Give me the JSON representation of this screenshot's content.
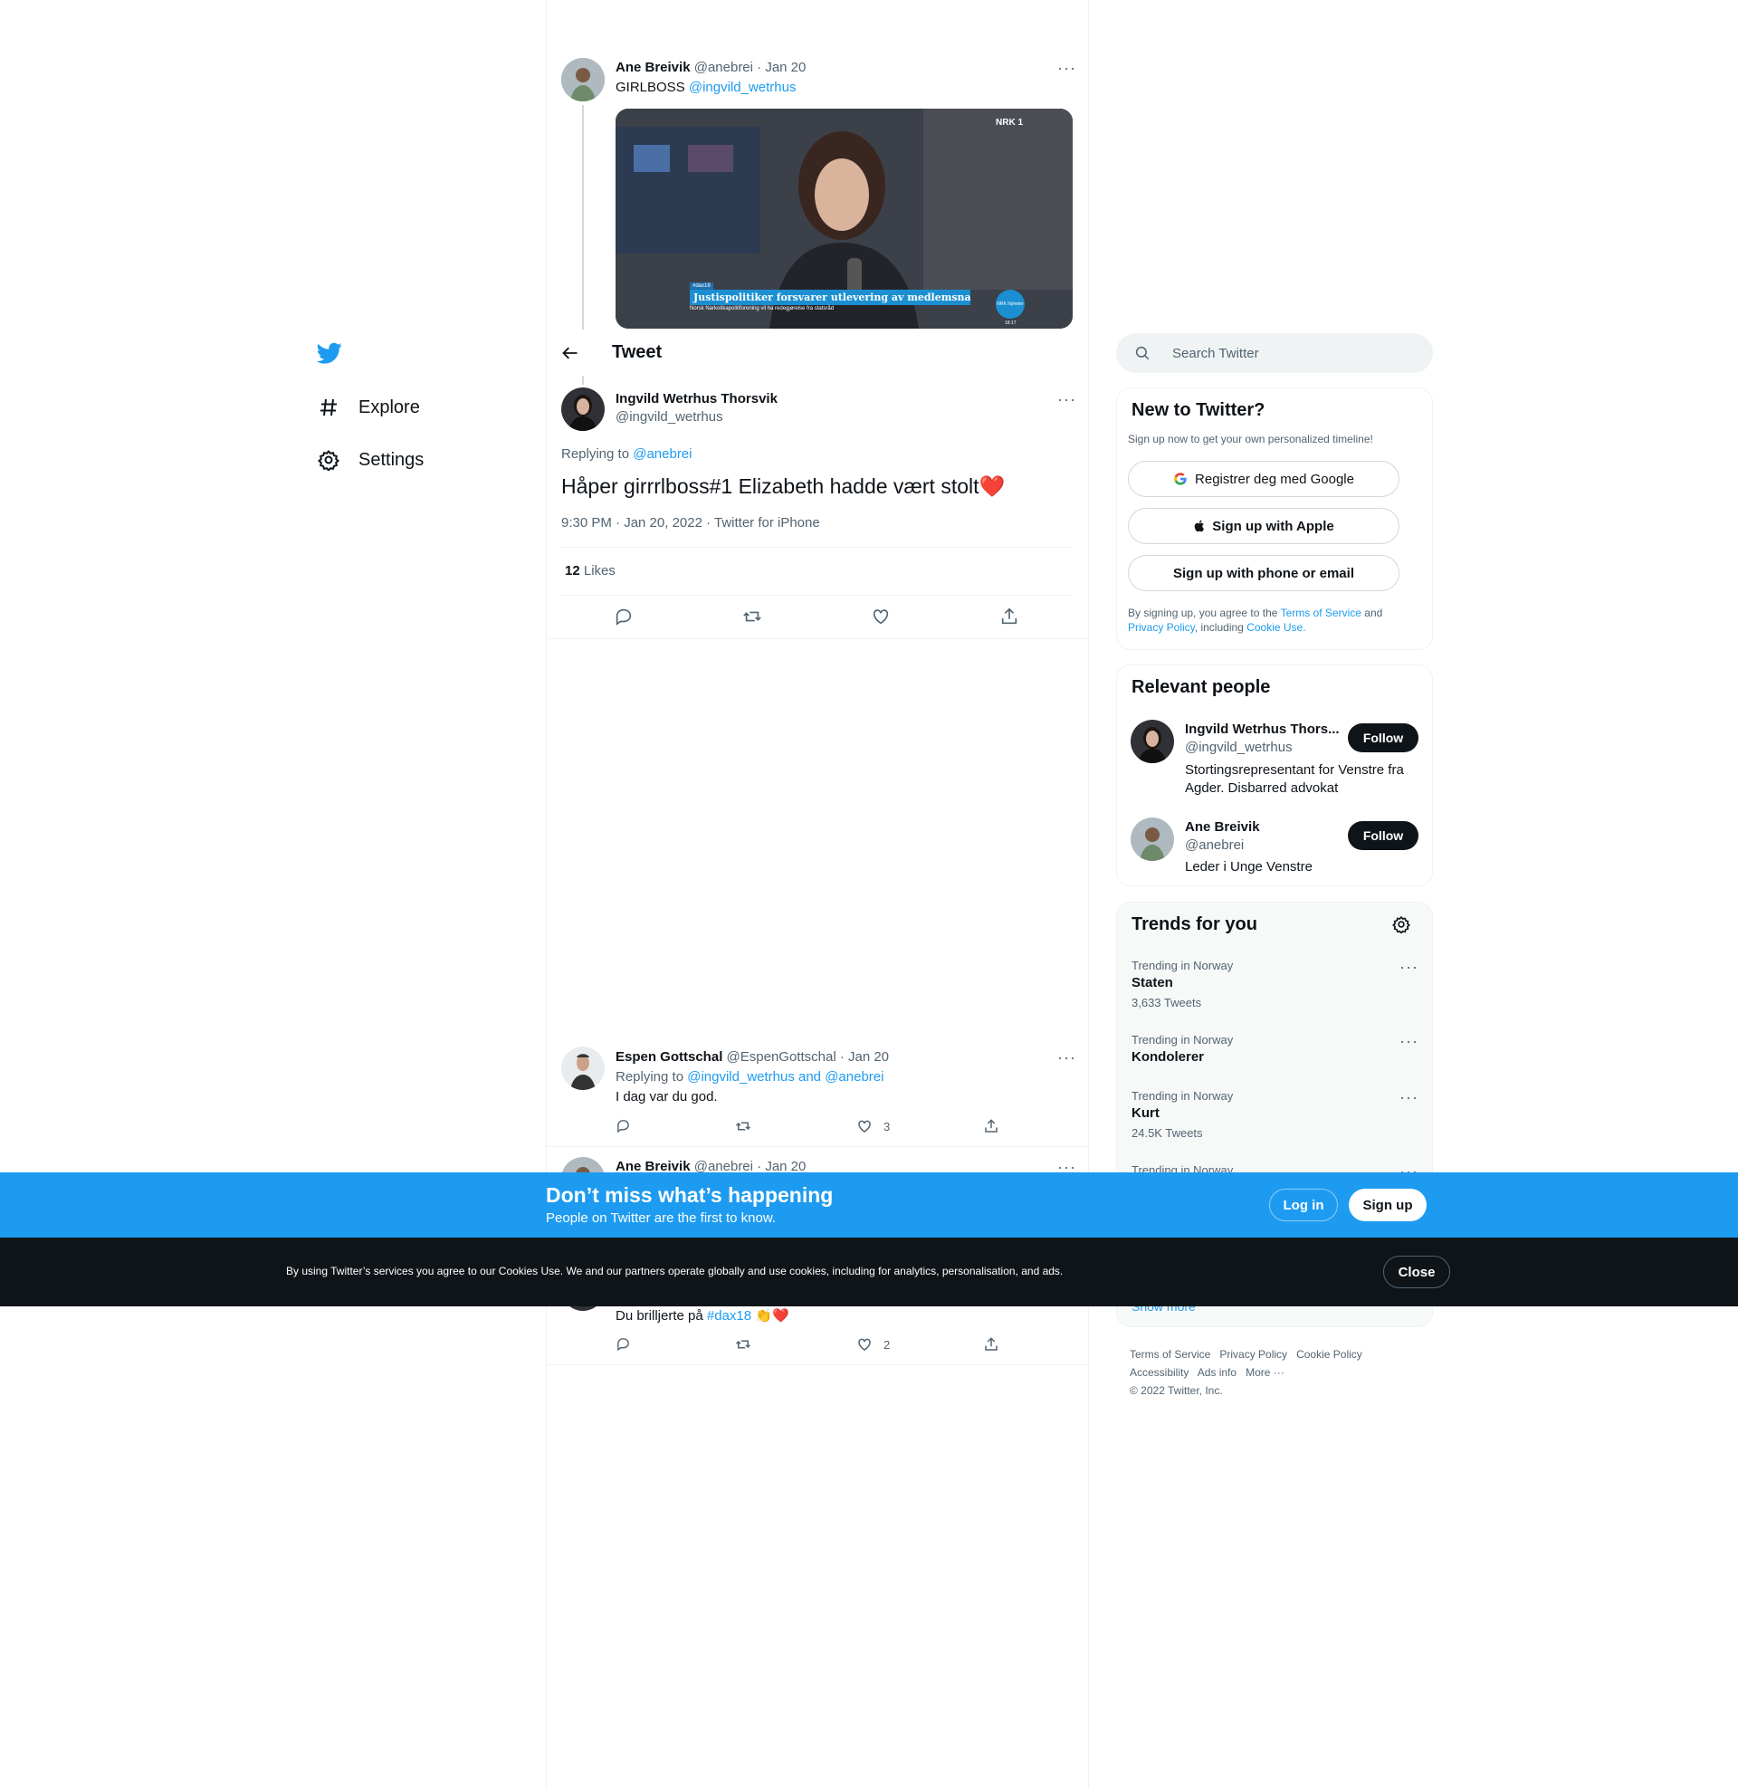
{
  "nav": {
    "explore": "Explore",
    "settings": "Settings"
  },
  "header": {
    "title": "Tweet"
  },
  "parent_tweet": {
    "name": "Ane Breivik",
    "handle": "@anebrei",
    "date": "· Jan 20",
    "text": "GIRLBOSS",
    "mention": "@ingvild_wetrhus",
    "image": {
      "logo": "NRK 1",
      "tag": "#dax18",
      "headline": "Justispolitiker forsvarer utlevering av medlemsnavn",
      "sub": "Norsk Narkotikapolitiforening vil ha redegjørelse fra statsråd",
      "badge": "NRK Nyheter",
      "time": "18:17"
    }
  },
  "main_tweet": {
    "name": "Ingvild Wetrhus Thorsvik",
    "handle": "@ingvild_wetrhus",
    "replying_label": "Replying to",
    "replying_to": "@anebrei",
    "text": "Håper girrrlboss#1 Elizabeth hadde vært stolt",
    "emoji": "❤️",
    "meta": "9:30 PM · Jan 20, 2022 · Twitter for iPhone",
    "likes_count": "12",
    "likes_label": "Likes"
  },
  "replies": [
    {
      "name": "Espen Gottschal",
      "handle": "@EspenGottschal",
      "date": "· Jan 20",
      "replying_label": "Replying to",
      "replying_to": "@ingvild_wetrhus and @anebrei",
      "text": "I dag var du god.",
      "likes": "3"
    },
    {
      "name": "Ane Breivik",
      "handle": "@anebrei",
      "date": "· Jan 20",
      "text": "Du brilljerte på",
      "hashtag": "#dax18",
      "emoji": "👏❤️",
      "likes": "2"
    }
  ],
  "search": {
    "placeholder": "Search Twitter"
  },
  "signup_card": {
    "title": "New to Twitter?",
    "subtitle": "Sign up now to get your own personalized timeline!",
    "google": "Registrer deg med Google",
    "apple": "Sign up with Apple",
    "phone": "Sign up with phone or email",
    "legal_1": "By signing up, you agree to the",
    "tos": "Terms of Service",
    "and": "and",
    "privacy": "Privacy Policy",
    "including": ", including",
    "cookie": "Cookie Use."
  },
  "relevant": {
    "title": "Relevant people",
    "people": [
      {
        "name": "Ingvild Wetrhus Thors...",
        "handle": "@ingvild_wetrhus",
        "bio": "Stortingsrepresentant for Venstre fra Agder. Disbarred advokat",
        "follow": "Follow"
      },
      {
        "name": "Ane Breivik",
        "handle": "@anebrei",
        "bio": "Leder i Unge Venstre",
        "follow": "Follow"
      }
    ]
  },
  "trends": {
    "title": "Trends for you",
    "items": [
      {
        "context": "Trending in Norway",
        "name": "Staten",
        "count": "3,633 Tweets"
      },
      {
        "context": "Trending in Norway",
        "name": "Kondolerer",
        "count": ""
      },
      {
        "context": "Trending in Norway",
        "name": "Kurt",
        "count": "24.5K Tweets"
      },
      {
        "context": "Trending in Norway",
        "name": "",
        "count": ""
      }
    ],
    "show_more": "Show more"
  },
  "footer": {
    "links": [
      "Terms of Service",
      "Privacy Policy",
      "Cookie Policy",
      "Accessibility",
      "Ads info",
      "More ···"
    ],
    "copyright": "© 2022 Twitter, Inc."
  },
  "banner": {
    "title": "Don’t miss what’s happening",
    "subtitle": "People on Twitter are the first to know.",
    "login": "Log in",
    "signup": "Sign up"
  },
  "cookie_bar": {
    "text": "By using Twitter’s services you agree to our Cookies Use. We and our partners operate globally and use cookies, including for analytics, personalisation, and ads.",
    "close": "Close"
  },
  "colors": {
    "accent": "#1d9bf0",
    "dark": "#0f1419",
    "gray": "#536471"
  }
}
